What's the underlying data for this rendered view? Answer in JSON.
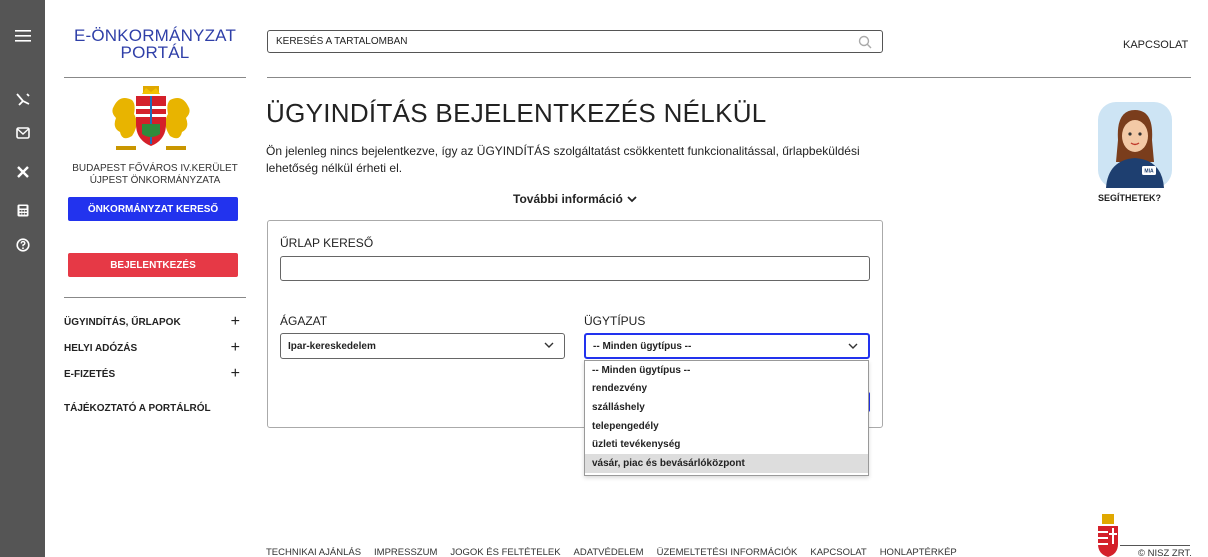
{
  "rail": {
    "icons": [
      "menu-icon",
      "scale-icon",
      "mail-icon",
      "tools-icon",
      "calculator-icon",
      "help-icon"
    ]
  },
  "sidebar": {
    "portal_title_line1": "E-ÖNKORMÁNYZAT",
    "portal_title_line2": "PORTÁL",
    "municipality_line1": "BUDAPEST FŐVÁROS IV.KERÜLET",
    "municipality_line2": "ÚJPEST ÖNKORMÁNYZATA",
    "search_button": "ÖNKORMÁNYZAT KERESŐ",
    "login_button": "BEJELENTKEZÉS",
    "nav": [
      {
        "label": "ÜGYINDÍTÁS, ŰRLAPOK",
        "plus": "+"
      },
      {
        "label": "HELYI ADÓZÁS",
        "plus": "+"
      },
      {
        "label": "E-FIZETÉS",
        "plus": "+"
      },
      {
        "label": "TÁJÉKOZTATÓ A PORTÁLRÓL",
        "plus": ""
      }
    ]
  },
  "header": {
    "search_placeholder": "KERESÉS A TARTALOMBAN",
    "contact": "KAPCSOLAT"
  },
  "main": {
    "title": "ÜGYINDÍTÁS BEJELENTKEZÉS NÉLKÜL",
    "lead_line1": "Ön jelenleg nincs bejelentkezve, így az ÜGYINDÍTÁS szolgáltatást csökkentett funkcionalitással, űrlapbeküldési",
    "lead_line2": "lehetőség nélkül érheti el.",
    "more_info": "További információ",
    "assistant_label": "SEGÍTHETEK?",
    "assistant_badge": "MIA"
  },
  "form": {
    "search_label": "ŰRLAP KERESŐ",
    "search_value": "",
    "sector_label": "ÁGAZAT",
    "sector_value": "Ipar-kereskedelem",
    "type_label": "ÜGYTÍPUS",
    "type_value": "-- Minden ügytípus --",
    "type_options": [
      "-- Minden ügytípus --",
      "rendezvény",
      "szálláshely",
      "telepengedély",
      "üzleti tevékenység",
      "vásár, piac és bevásárlóközpont"
    ],
    "highlighted_option": 5
  },
  "footer": {
    "links": [
      "TECHNIKAI AJÁNLÁS",
      "IMPRESSZUM",
      "JOGOK ÉS FELTÉTELEK",
      "ADATVÉDELEM",
      "ÜZEMELTETÉSI INFORMÁCIÓK",
      "KAPCSOLAT",
      "HONLAPTÉRKÉP"
    ],
    "copyright": "© NISZ ZRT."
  },
  "colors": {
    "brand_blue": "#2f3fa8",
    "button_blue": "#2233ee",
    "button_red": "#e63946",
    "rail": "#555555"
  }
}
